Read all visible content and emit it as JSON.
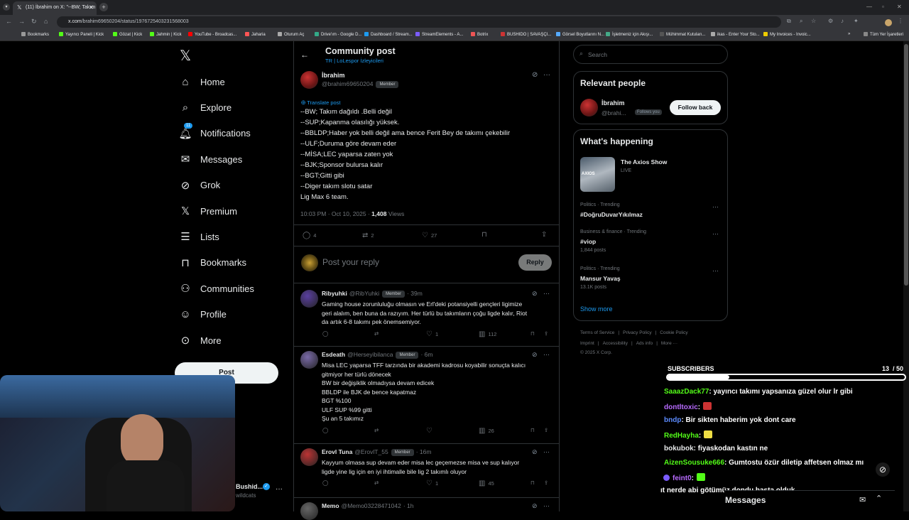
{
  "browser": {
    "tab_title": "(11) İbrahim on X: \"--BW; Takım",
    "url_host": "x.com",
    "url_path": "/brahim69650204/status/1976725403231568003",
    "bookmarks": [
      "Bookmarks",
      "Yayıncı Paneli | Kick",
      "Gözat | Kick",
      "Jahmin | Kick",
      "YouTube - Broadcas...",
      "Jaharia",
      "Oturum Aç",
      "Drive'ım - Google D...",
      "Dashboard / Stream...",
      "StreamElements - A...",
      "Botrix",
      "BUSHIDO | SAVAŞÇI...",
      "Görsel Boyutlarını N...",
      "İşletmeniz için Akışı...",
      "Mühimmat Kutuları...",
      "ikas - Enter Your Sto...",
      "My Invoices - Invoic..."
    ],
    "all_bookmarks": "Tüm Yer İşaretleri"
  },
  "nav": {
    "items": [
      {
        "label": "Home",
        "icon": "home-icon"
      },
      {
        "label": "Explore",
        "icon": "search-icon"
      },
      {
        "label": "Notifications",
        "icon": "bell-icon",
        "badge": "11"
      },
      {
        "label": "Messages",
        "icon": "mail-icon"
      },
      {
        "label": "Grok",
        "icon": "grok-icon"
      },
      {
        "label": "Premium",
        "icon": "x-logo-icon"
      },
      {
        "label": "Lists",
        "icon": "list-icon"
      },
      {
        "label": "Bookmarks",
        "icon": "bookmark-icon"
      },
      {
        "label": "Communities",
        "icon": "people-icon"
      },
      {
        "label": "Profile",
        "icon": "person-icon"
      },
      {
        "label": "More",
        "icon": "more-circle-icon"
      }
    ],
    "post_button": "Post",
    "account_name": "Bushid...",
    "account_handle": "wildcats"
  },
  "header": {
    "title": "Community post",
    "subtitle": "TR | LoLespor İzleyicileri"
  },
  "post": {
    "author": "İbrahim",
    "handle": "@brahim69650204",
    "badge": "Member",
    "translate": "Translate post",
    "lines": [
      "--BW; Takım dağıldı .Belli değil",
      "--SUP;Kapanma olasılığı yüksek.",
      "--BBLDP;Haber yok belli değil ama bence Ferit Bey de takımı çekebilir",
      "--ULF;Duruma göre devam eder",
      "--MİSA;LEC yaparsa zaten yok",
      "--BJK;Sponsor bulursa kalır",
      "--BGT;Gitti gibi",
      "--Diger takım slotu satar",
      "Lig Max 6 team."
    ],
    "time": "10:03 PM · Oct 10, 2025 · ",
    "views": "1,408",
    "views_label": " Views",
    "replies": "4",
    "reposts": "2",
    "likes": "27"
  },
  "reply_box": {
    "placeholder": "Post your reply",
    "button": "Reply"
  },
  "replies": [
    {
      "name": "Ribyuhki",
      "handle": "@RibYuhki",
      "badge": "Member",
      "time": "· 39m",
      "text": [
        "Gaming house zorunluluğu olmasın ve Erl'deki potansiyelli gençleri ligimize",
        "geri alalım, ben buna da razıyım. Her türlü bu takımların çoğu ligde kalır, Riot",
        "da artık 6-8 takımı pek önemsemiyor."
      ],
      "likes": "1",
      "views": "112"
    },
    {
      "name": "Esdeath",
      "handle": "@Herseyibilanca",
      "badge": "Member",
      "time": "· 6m",
      "text": [
        "Misa LEC yaparsa TFF tarzında bir akademi kadrosu koyabilir sonuçta kalıcı",
        "gitmiyor her türlü dönecek",
        "BW bir değişiklik olmadıysa devam edicek",
        "BBLDP ile BJK de bence kapatmaz",
        "BGT %100",
        "ULF SUP %99 gitti",
        "Şu an 5 takımız"
      ],
      "likes": "",
      "views": "26"
    },
    {
      "name": "Erovl Tuna",
      "handle": "@ErovlT_55",
      "badge": "Member",
      "time": "· 16m",
      "text": [
        "Kayyum olmasa sup devam eder misa lec geçemezse misa ve sup kalıyor",
        "ligde yine lig için en iyi ihtimalle bile lig 2 takımlı oluyor"
      ],
      "likes": "1",
      "views": "45"
    },
    {
      "name": "Memo",
      "handle": "@Memo03228471042",
      "badge": "",
      "time": "· 1h",
      "text": [],
      "likes": "",
      "views": ""
    }
  ],
  "right": {
    "search_placeholder": "Search",
    "relevant_title": "Relevant people",
    "rel_name": "İbrahim",
    "rel_handle": "@brahi...",
    "rel_follows": "Follows you",
    "follow_back": "Follow back",
    "happening_title": "What's happening",
    "live_show": "The Axios Show",
    "live_label": "LIVE",
    "axios_logo": "AXIOS",
    "trends": [
      {
        "cat": "Politics · Trending",
        "name": "#DoğruDuvarYıkılmaz",
        "count": ""
      },
      {
        "cat": "Business & finance · Trending",
        "name": "#viop",
        "count": "1,844 posts"
      },
      {
        "cat": "Politics · Trending",
        "name": "Mansur Yavaş",
        "count": "13.1K posts"
      }
    ],
    "show_more": "Show more",
    "footer1": [
      "Terms of Service",
      "Privacy Policy",
      "Cookie Policy"
    ],
    "footer2": [
      "Imprint",
      "Accessibility",
      "Ads info",
      "More ···"
    ],
    "copyright": "© 2025 X Corp."
  },
  "overlay": {
    "subs_label": "SUBSCRIBERS",
    "subs_count": "13",
    "subs_goal": "/ 50",
    "subs_progress": 0.26,
    "messages_label": "Messages",
    "chat": [
      {
        "user": "SaaazDack77",
        "color": "#53fc18",
        "msg": ": yayıncı takımı yapsanıza güzel olur lr gibi"
      },
      {
        "user": "dontltoxic",
        "color": "#b86bff",
        "msg": ":"
      },
      {
        "user": "bndp",
        "color": "#5c8cff",
        "msg": ": Bir sikten haberim yok dont care"
      },
      {
        "user": "RedHayha",
        "color": "#53fc18",
        "msg": ":"
      },
      {
        "user": "bokubok",
        "color": "#e7e9ea",
        "msg": ": fiyaskodan kastın ne"
      },
      {
        "user": "AizenSousuke666",
        "color": "#53fc18",
        "msg": ": Gumtostu özür diletip affetsen olmaz mı"
      },
      {
        "user": "feint0",
        "color": "#b86bff",
        "msg": ":"
      },
      {
        "user": "",
        "color": "#fff",
        "msg": "ıt nerde abi götümüz dondu hasta olduk"
      }
    ]
  }
}
